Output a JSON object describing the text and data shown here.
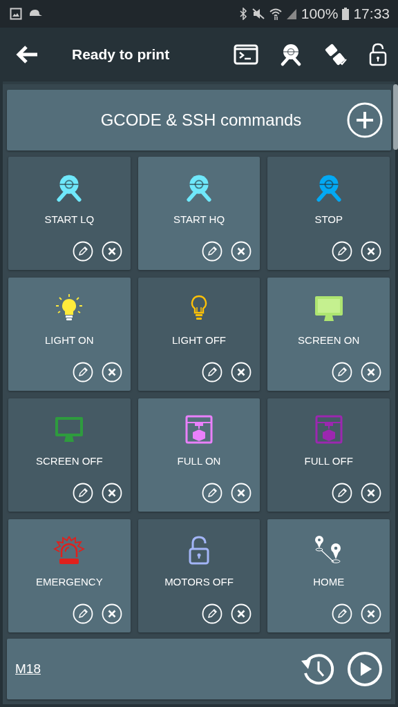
{
  "status_bar": {
    "battery": "100%",
    "time": "17:33"
  },
  "toolbar": {
    "title": "Ready to print"
  },
  "header": {
    "title": "GCODE & SSH commands"
  },
  "commands": [
    {
      "label": "START LQ",
      "kind": "webcam",
      "color": "#6fe8fb"
    },
    {
      "label": "START HQ",
      "kind": "webcam",
      "color": "#6fe8fb"
    },
    {
      "label": "STOP",
      "kind": "webcam",
      "color": "#03a9f4"
    },
    {
      "label": "LIGHT ON",
      "kind": "bulb-on",
      "color": "#ffeb3b"
    },
    {
      "label": "LIGHT OFF",
      "kind": "bulb-off",
      "color": "#ffc107"
    },
    {
      "label": "SCREEN ON",
      "kind": "monitor",
      "color": "#aee571"
    },
    {
      "label": "SCREEN OFF",
      "kind": "monitor",
      "color": "#2e9b3e"
    },
    {
      "label": "FULL ON",
      "kind": "printer",
      "color": "#ea80fc"
    },
    {
      "label": "FULL OFF",
      "kind": "printer",
      "color": "#9c27b0"
    },
    {
      "label": "EMERGENCY",
      "kind": "siren",
      "color": "#e0201c"
    },
    {
      "label": "MOTORS OFF",
      "kind": "lock",
      "color": "#a3b5f7"
    },
    {
      "label": "HOME",
      "kind": "pins",
      "color": "#ffffff"
    }
  ],
  "command_bar": {
    "value": "M18"
  }
}
